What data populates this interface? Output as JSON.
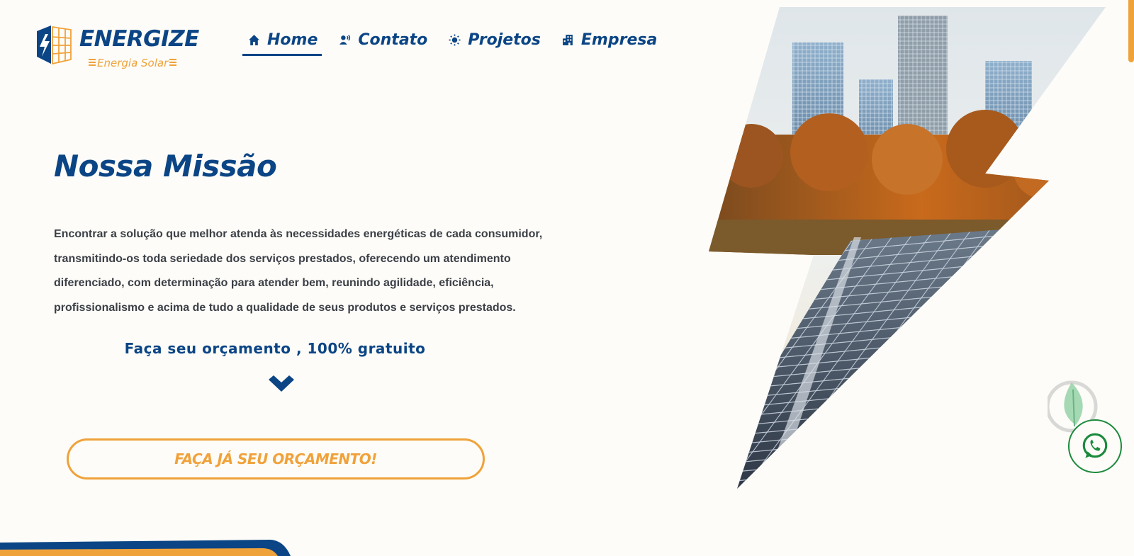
{
  "brand": {
    "name": "ENERGIZE",
    "tagline": "Energia Solar"
  },
  "nav": {
    "items": [
      {
        "label": "Home",
        "icon": "home-icon",
        "active": true
      },
      {
        "label": "Contato",
        "icon": "phone-contact-icon"
      },
      {
        "label": "Projetos",
        "icon": "sun-icon"
      },
      {
        "label": "Empresa",
        "icon": "building-icon"
      }
    ]
  },
  "hero": {
    "title": "Nossa Missão",
    "mission": "Encontrar a solução que melhor atenda às necessidades energéticas de cada consumidor, transmitindo-os toda seriedade dos serviços prestados, oferecendo um atendimento diferenciado, com determinação para atender bem, reunindo agilidade, eficiência, profissionalismo e acima de tudo a qualidade de seus produtos e serviços prestados.",
    "cta_text": "Faça seu orçamento , 100% gratuito",
    "cta_button": "FAÇA JÁ SEU ORÇAMENTO!"
  },
  "floating": {
    "icon": "whatsapp-icon",
    "decor_icon": "leaf-bulb-icon"
  },
  "colors": {
    "primary": "#0b4585",
    "accent": "#f0a23a",
    "background": "#fdfcf8",
    "text": "#3b3f46",
    "whatsapp": "#1b8a3c"
  }
}
